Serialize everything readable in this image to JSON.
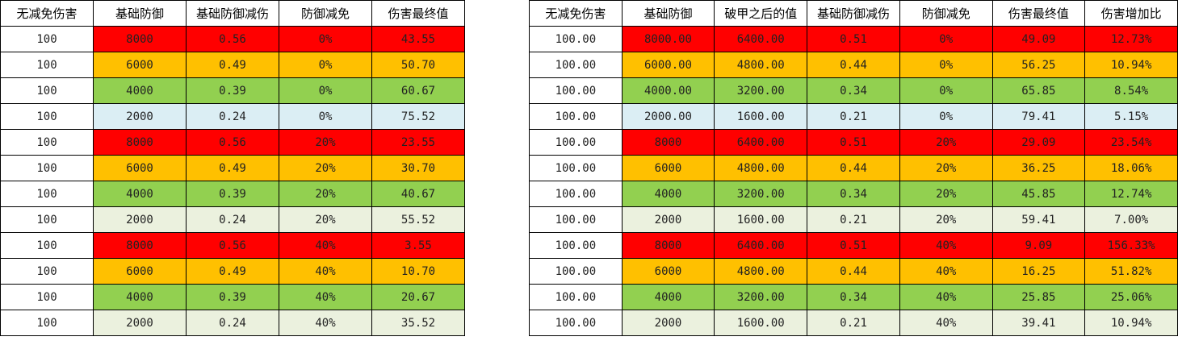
{
  "colors": {
    "red": "#ff0000",
    "orange": "#ffc000",
    "green": "#92d050",
    "lightblue": "#dbeef4",
    "beige": "#ebf1de",
    "border": "#000000"
  },
  "left_table": {
    "headers": [
      "无减免伤害",
      "基础防御",
      "基础防御减伤",
      "防御减免",
      "伤害最终值"
    ],
    "rows": [
      {
        "color": "red",
        "cells": [
          "100",
          "8000",
          "0.56",
          "0%",
          "43.55"
        ]
      },
      {
        "color": "orange",
        "cells": [
          "100",
          "6000",
          "0.49",
          "0%",
          "50.70"
        ]
      },
      {
        "color": "green",
        "cells": [
          "100",
          "4000",
          "0.39",
          "0%",
          "60.67"
        ]
      },
      {
        "color": "lightblue",
        "cells": [
          "100",
          "2000",
          "0.24",
          "0%",
          "75.52"
        ]
      },
      {
        "color": "red",
        "cells": [
          "100",
          "8000",
          "0.56",
          "20%",
          "23.55"
        ]
      },
      {
        "color": "orange",
        "cells": [
          "100",
          "6000",
          "0.49",
          "20%",
          "30.70"
        ]
      },
      {
        "color": "green",
        "cells": [
          "100",
          "4000",
          "0.39",
          "20%",
          "40.67"
        ]
      },
      {
        "color": "beige",
        "cells": [
          "100",
          "2000",
          "0.24",
          "20%",
          "55.52"
        ]
      },
      {
        "color": "red",
        "cells": [
          "100",
          "8000",
          "0.56",
          "40%",
          "3.55"
        ]
      },
      {
        "color": "orange",
        "cells": [
          "100",
          "6000",
          "0.49",
          "40%",
          "10.70"
        ]
      },
      {
        "color": "green",
        "cells": [
          "100",
          "4000",
          "0.39",
          "40%",
          "20.67"
        ]
      },
      {
        "color": "beige",
        "cells": [
          "100",
          "2000",
          "0.24",
          "40%",
          "35.52"
        ]
      }
    ]
  },
  "right_table": {
    "headers": [
      "无减免伤害",
      "基础防御",
      "破甲之后的值",
      "基础防御减伤",
      "防御减免",
      "伤害最终值",
      "伤害增加比"
    ],
    "rows": [
      {
        "color": "red",
        "cells": [
          "100.00",
          "8000.00",
          "6400.00",
          "0.51",
          "0%",
          "49.09",
          "12.73%"
        ]
      },
      {
        "color": "orange",
        "cells": [
          "100.00",
          "6000.00",
          "4800.00",
          "0.44",
          "0%",
          "56.25",
          "10.94%"
        ]
      },
      {
        "color": "green",
        "cells": [
          "100.00",
          "4000.00",
          "3200.00",
          "0.34",
          "0%",
          "65.85",
          "8.54%"
        ]
      },
      {
        "color": "lightblue",
        "cells": [
          "100.00",
          "2000.00",
          "1600.00",
          "0.21",
          "0%",
          "79.41",
          "5.15%"
        ]
      },
      {
        "color": "red",
        "cells": [
          "100.00",
          "8000",
          "6400.00",
          "0.51",
          "20%",
          "29.09",
          "23.54%"
        ]
      },
      {
        "color": "orange",
        "cells": [
          "100.00",
          "6000",
          "4800.00",
          "0.44",
          "20%",
          "36.25",
          "18.06%"
        ]
      },
      {
        "color": "green",
        "cells": [
          "100.00",
          "4000",
          "3200.00",
          "0.34",
          "20%",
          "45.85",
          "12.74%"
        ]
      },
      {
        "color": "beige",
        "cells": [
          "100.00",
          "2000",
          "1600.00",
          "0.21",
          "20%",
          "59.41",
          "7.00%"
        ]
      },
      {
        "color": "red",
        "cells": [
          "100.00",
          "8000",
          "6400.00",
          "0.51",
          "40%",
          "9.09",
          "156.33%"
        ]
      },
      {
        "color": "orange",
        "cells": [
          "100.00",
          "6000",
          "4800.00",
          "0.44",
          "40%",
          "16.25",
          "51.82%"
        ]
      },
      {
        "color": "green",
        "cells": [
          "100.00",
          "4000",
          "3200.00",
          "0.34",
          "40%",
          "25.85",
          "25.06%"
        ]
      },
      {
        "color": "beige",
        "cells": [
          "100.00",
          "2000",
          "1600.00",
          "0.21",
          "40%",
          "39.41",
          "10.94%"
        ]
      }
    ]
  }
}
